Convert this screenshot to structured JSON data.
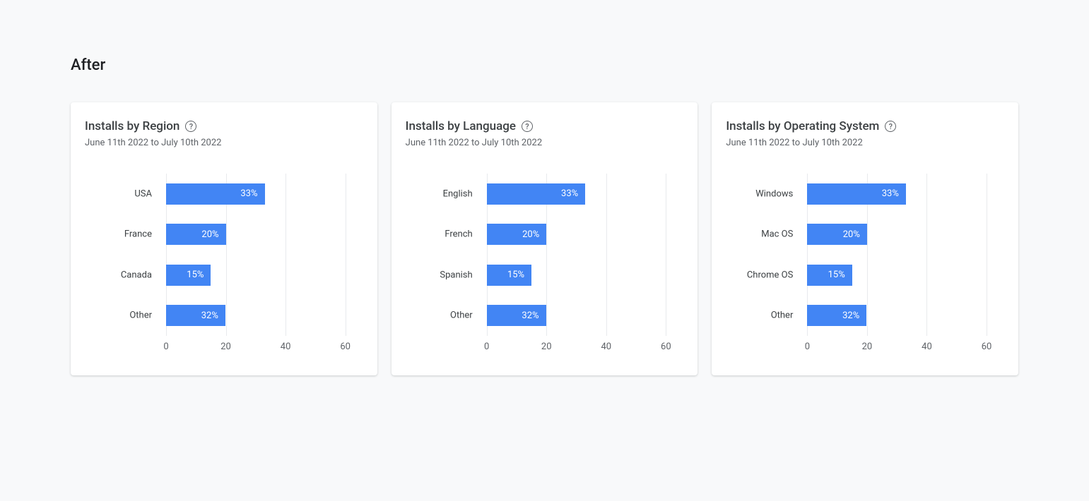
{
  "page_title": "After",
  "date_range": "June 11th 2022 to July 10th 2022",
  "axis": {
    "max": 60,
    "ticks": [
      0,
      20,
      40,
      60
    ]
  },
  "bar_color": "#4285f4",
  "cards": [
    {
      "title": "Installs by Region",
      "categories": [
        "USA",
        "France",
        "Canada",
        "Other"
      ],
      "values": [
        33,
        20,
        15,
        32
      ],
      "value_labels": [
        "33%",
        "20%",
        "15%",
        "32%"
      ]
    },
    {
      "title": "Installs by Language",
      "categories": [
        "English",
        "French",
        "Spanish",
        "Other"
      ],
      "values": [
        33,
        20,
        15,
        32
      ],
      "value_labels": [
        "33%",
        "20%",
        "15%",
        "32%"
      ]
    },
    {
      "title": "Installs by Operating System",
      "categories": [
        "Windows",
        "Mac OS",
        "Chrome OS",
        "Other"
      ],
      "values": [
        33,
        20,
        15,
        32
      ],
      "value_labels": [
        "33%",
        "20%",
        "15%",
        "32%"
      ]
    }
  ],
  "chart_data": [
    {
      "type": "bar",
      "orientation": "horizontal",
      "title": "Installs by Region",
      "subtitle": "June 11th 2022 to July 10th 2022",
      "categories": [
        "USA",
        "France",
        "Canada",
        "Other"
      ],
      "values": [
        33,
        20,
        15,
        32
      ],
      "xlabel": "",
      "ylabel": "",
      "xlim": [
        0,
        60
      ],
      "x_ticks": [
        0,
        20,
        40,
        60
      ]
    },
    {
      "type": "bar",
      "orientation": "horizontal",
      "title": "Installs by Language",
      "subtitle": "June 11th 2022 to July 10th 2022",
      "categories": [
        "English",
        "French",
        "Spanish",
        "Other"
      ],
      "values": [
        33,
        20,
        15,
        32
      ],
      "xlabel": "",
      "ylabel": "",
      "xlim": [
        0,
        60
      ],
      "x_ticks": [
        0,
        20,
        40,
        60
      ]
    },
    {
      "type": "bar",
      "orientation": "horizontal",
      "title": "Installs by Operating System",
      "subtitle": "June 11th 2022 to July 10th 2022",
      "categories": [
        "Windows",
        "Mac OS",
        "Chrome OS",
        "Other"
      ],
      "values": [
        33,
        20,
        15,
        32
      ],
      "xlabel": "",
      "ylabel": "",
      "xlim": [
        0,
        60
      ],
      "x_ticks": [
        0,
        20,
        40,
        60
      ]
    }
  ]
}
